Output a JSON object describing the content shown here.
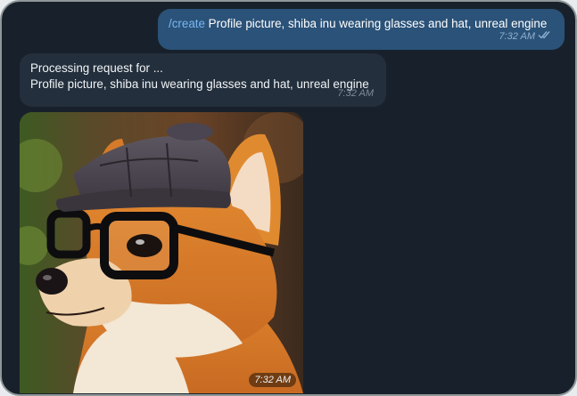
{
  "messages": {
    "outgoing": {
      "command": "/create",
      "text": " Profile picture, shiba inu wearing glasses and hat, unreal engine",
      "time": "7:32 AM",
      "status_icon": "double-check-icon"
    },
    "incoming_text": {
      "line1": "Processing request for ...",
      "line2": "Profile picture, shiba inu wearing glasses and hat, unreal engine",
      "time": "7:32 AM"
    },
    "incoming_image": {
      "time": "7:32 AM"
    }
  },
  "colors": {
    "chat_bg": "#18212b",
    "outgoing_bubble": "#2b5278",
    "incoming_bubble": "#232f3c",
    "command_link": "#79b7f4"
  }
}
